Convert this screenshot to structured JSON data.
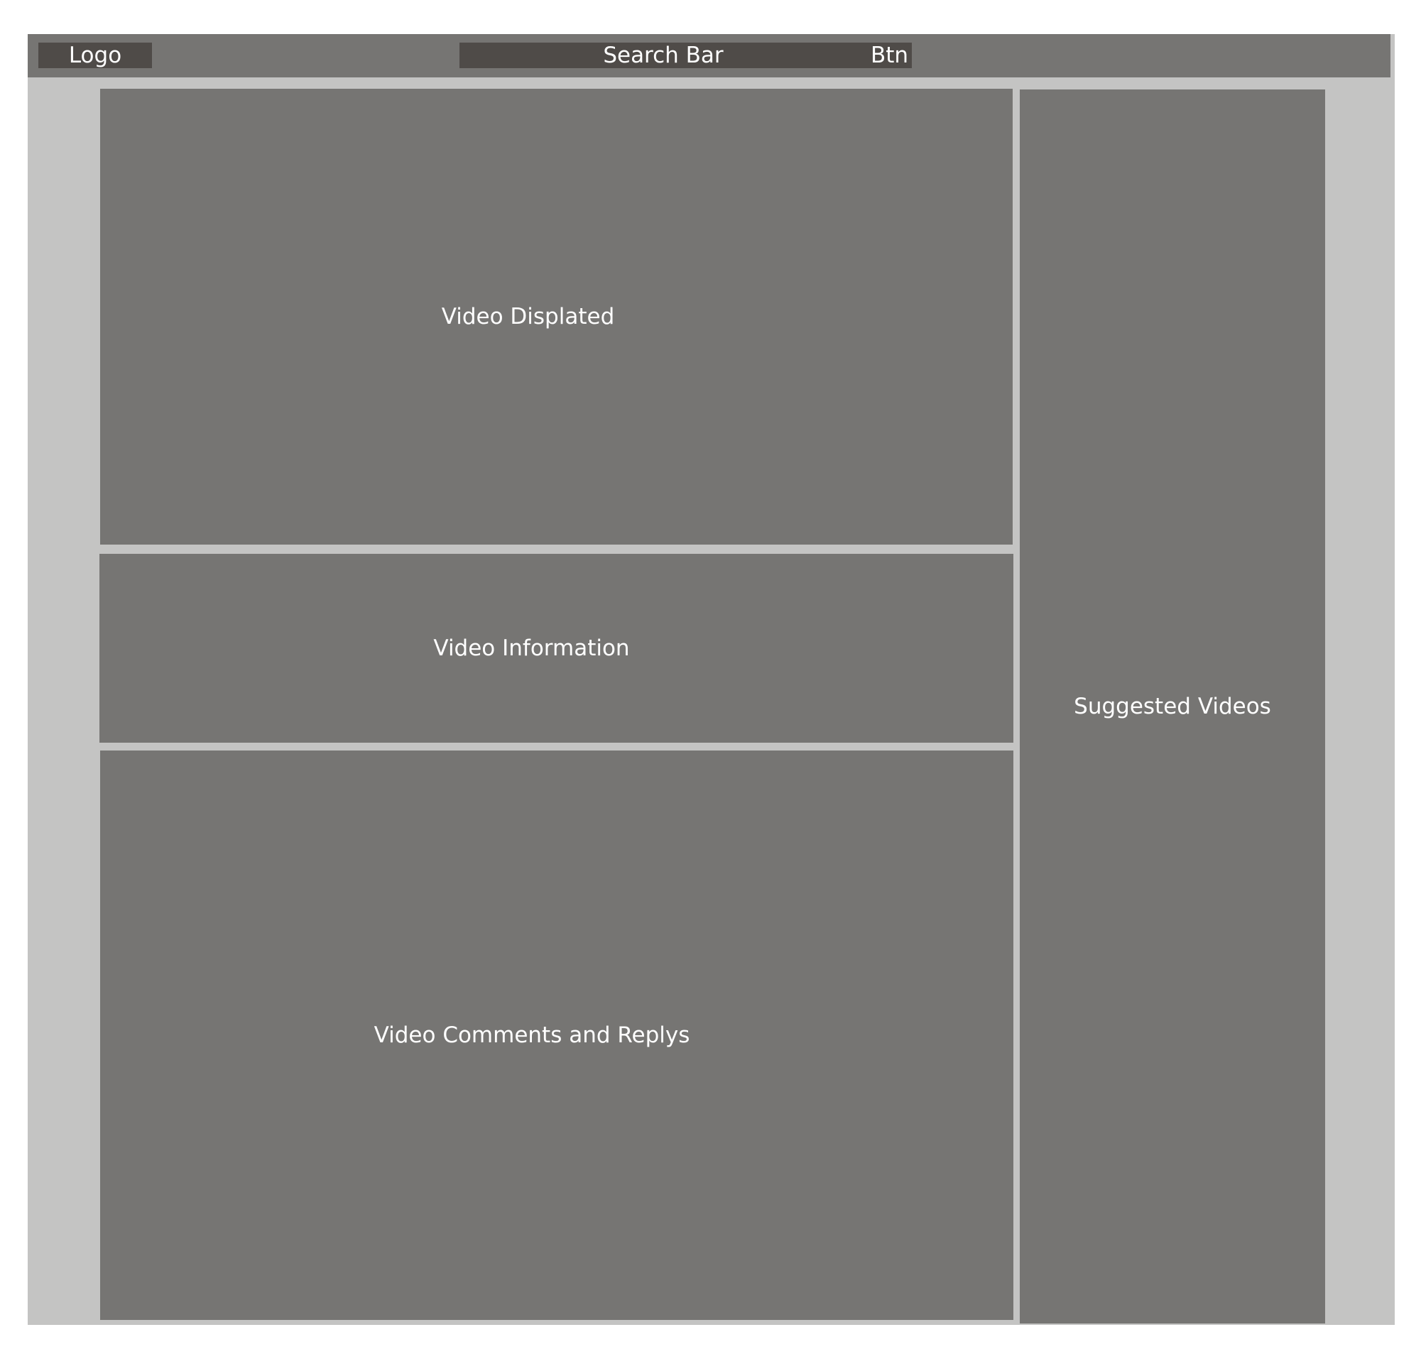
{
  "header": {
    "logo_label": "Logo",
    "search_label": "Search Bar",
    "button_label": "Btn"
  },
  "main": {
    "video_display_label": "Video Displated",
    "video_info_label": "Video Information",
    "video_comments_label": "Video Comments and Replys"
  },
  "sidebar": {
    "suggested_label": "Suggested Videos"
  },
  "colors": {
    "frame_background": "#c4c4c3",
    "panel_background": "#767573",
    "header_control_background": "#4f4b48",
    "text": "#ffffff"
  }
}
